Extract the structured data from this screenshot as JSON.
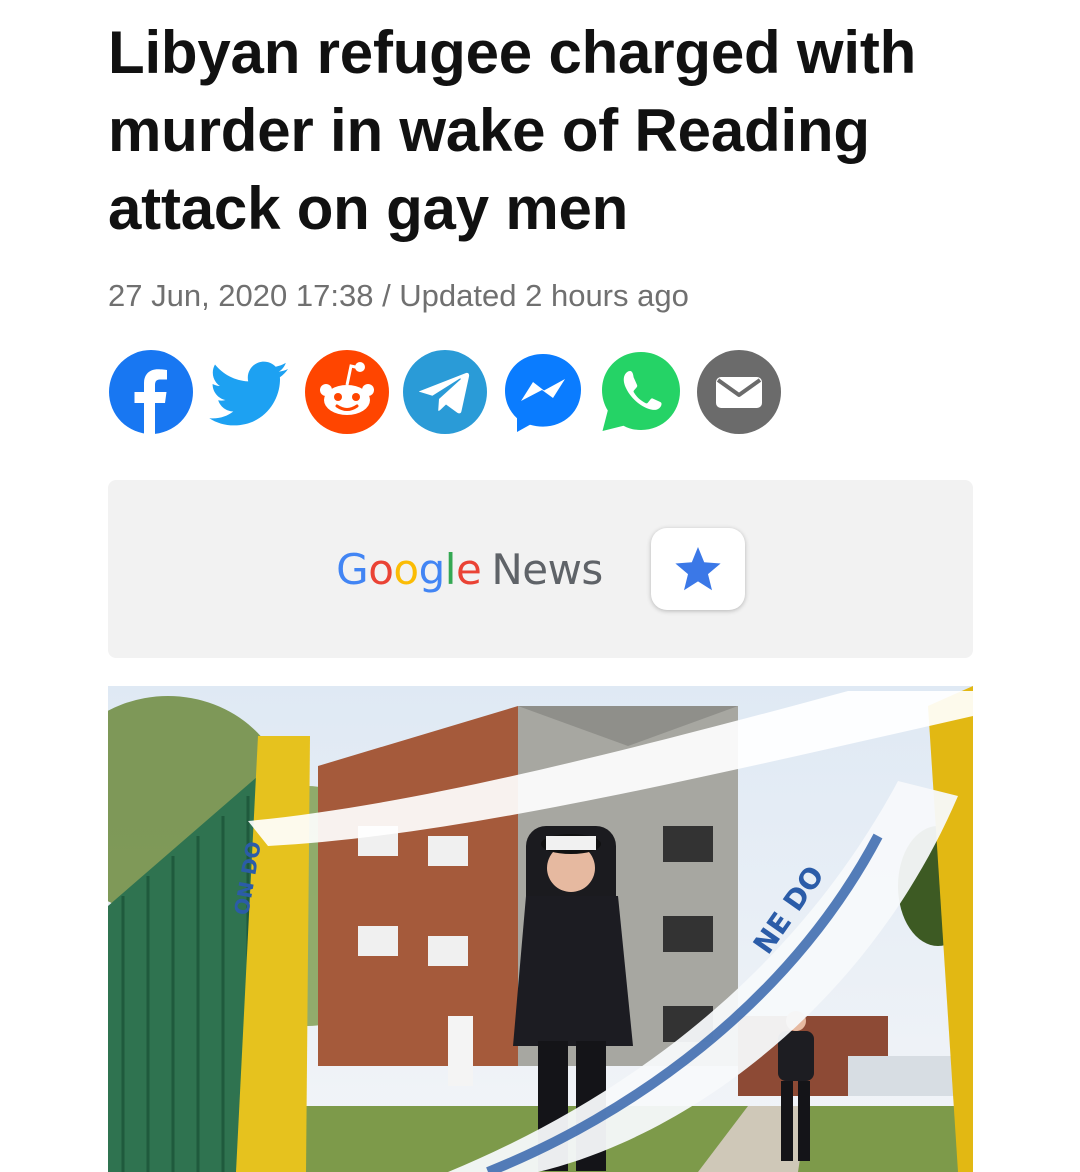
{
  "article": {
    "headline": "Libyan refugee charged with murder in wake of Reading attack on gay men",
    "meta": "27 Jun, 2020 17:38 / Updated 2 hours ago"
  },
  "share": {
    "buttons": [
      {
        "name": "facebook",
        "icon": "facebook-icon",
        "color": "#1877F2"
      },
      {
        "name": "twitter",
        "icon": "twitter-icon",
        "color": "#1DA1F2"
      },
      {
        "name": "reddit",
        "icon": "reddit-icon",
        "color": "#FF4500"
      },
      {
        "name": "telegram",
        "icon": "telegram-icon",
        "color": "#2A9BD7"
      },
      {
        "name": "messenger",
        "icon": "messenger-icon",
        "color": "#0A7CFF"
      },
      {
        "name": "whatsapp",
        "icon": "whatsapp-icon",
        "color": "#25D366"
      },
      {
        "name": "email",
        "icon": "envelope-icon",
        "color": "#6B6B6B"
      }
    ]
  },
  "google_news": {
    "letters": [
      "G",
      "o",
      "o",
      "g",
      "l",
      "e"
    ],
    "word": "News",
    "follow_icon": "star-icon",
    "star_color": "#3B78E7"
  },
  "photo": {
    "tape_text_left": "ON DO",
    "tape_text_right": "NE DO"
  }
}
